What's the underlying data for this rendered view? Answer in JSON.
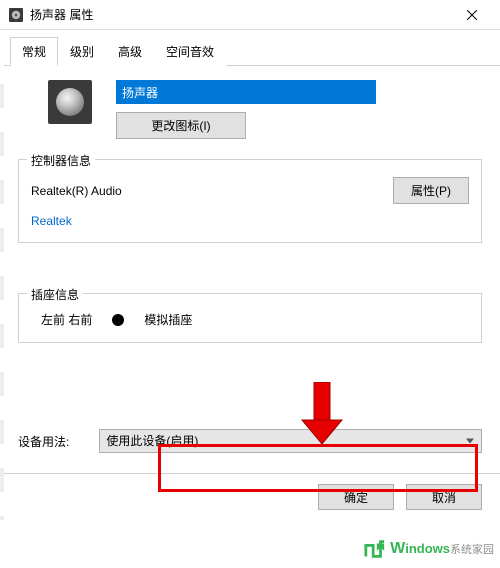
{
  "window": {
    "title": "扬声器 属性"
  },
  "tabs": [
    {
      "label": "常规"
    },
    {
      "label": "级别"
    },
    {
      "label": "高级"
    },
    {
      "label": "空间音效"
    }
  ],
  "device": {
    "name_value": "扬声器",
    "change_icon_btn": "更改图标(I)"
  },
  "controller": {
    "fieldset_title": "控制器信息",
    "name": "Realtek(R) Audio",
    "vendor_link": "Realtek",
    "props_btn": "属性(P)"
  },
  "jack": {
    "fieldset_title": "插座信息",
    "location": "左前  右前",
    "type": "模拟插座"
  },
  "usage": {
    "label": "设备用法:",
    "selected": "使用此设备(启用)"
  },
  "footer": {
    "ok": "确定",
    "cancel": "取消"
  },
  "watermark": {
    "brand": "indows",
    "suffix": "系统家园"
  }
}
